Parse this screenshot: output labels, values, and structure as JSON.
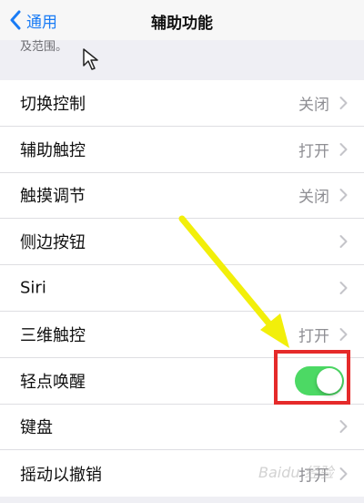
{
  "nav": {
    "back_label": "通用",
    "title": "辅助功能"
  },
  "description_text": "及范围。",
  "rows": [
    {
      "label": "切换控制",
      "value": "关闭",
      "type": "disclosure"
    },
    {
      "label": "辅助触控",
      "value": "打开",
      "type": "disclosure"
    },
    {
      "label": "触摸调节",
      "value": "关闭",
      "type": "disclosure"
    },
    {
      "label": "侧边按钮",
      "value": "",
      "type": "disclosure"
    },
    {
      "label": "Siri",
      "value": "",
      "type": "disclosure"
    },
    {
      "label": "三维触控",
      "value": "打开",
      "type": "disclosure"
    },
    {
      "label": "轻点唤醒",
      "value": "",
      "type": "toggle",
      "on": true
    },
    {
      "label": "键盘",
      "value": "",
      "type": "disclosure"
    },
    {
      "label": "摇动以撤销",
      "value": "打开",
      "type": "disclosure"
    }
  ],
  "colors": {
    "accent": "#1a7cf5",
    "toggle_on": "#4cd964",
    "highlight_box": "#e52a2a",
    "arrow": "#f2ef0a"
  },
  "icons": [
    "chevron-left-icon",
    "chevron-right-icon",
    "cursor-icon"
  ],
  "watermark": "Baidu 经验"
}
